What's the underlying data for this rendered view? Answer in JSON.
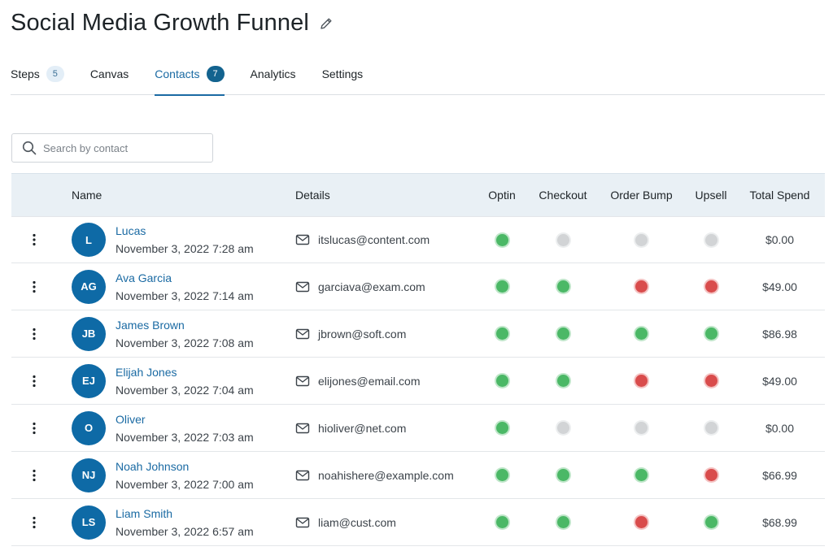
{
  "header": {
    "title": "Social Media Growth Funnel"
  },
  "tabs": [
    {
      "label": "Steps",
      "badge": "5"
    },
    {
      "label": "Canvas"
    },
    {
      "label": "Contacts",
      "badge": "7"
    },
    {
      "label": "Analytics"
    },
    {
      "label": "Settings"
    }
  ],
  "search": {
    "placeholder": "Search by contact"
  },
  "table": {
    "headers": {
      "name": "Name",
      "details": "Details",
      "optin": "Optin",
      "checkout": "Checkout",
      "order_bump": "Order Bump",
      "upsell": "Upsell",
      "total_spend": "Total Spend"
    },
    "rows": [
      {
        "initials": "L",
        "name": "Lucas",
        "date": "November 3, 2022 7:28 am",
        "email": "itslucas@content.com",
        "optin": "green",
        "checkout": "gray",
        "order_bump": "gray",
        "upsell": "gray",
        "spend": "$0.00"
      },
      {
        "initials": "AG",
        "name": "Ava Garcia",
        "date": "November 3, 2022 7:14 am",
        "email": "garciava@exam.com",
        "optin": "green",
        "checkout": "green",
        "order_bump": "red",
        "upsell": "red",
        "spend": "$49.00"
      },
      {
        "initials": "JB",
        "name": "James Brown",
        "date": "November 3, 2022 7:08 am",
        "email": "jbrown@soft.com",
        "optin": "green",
        "checkout": "green",
        "order_bump": "green",
        "upsell": "green",
        "spend": "$86.98"
      },
      {
        "initials": "EJ",
        "name": "Elijah Jones",
        "date": "November 3, 2022 7:04 am",
        "email": "elijones@email.com",
        "optin": "green",
        "checkout": "green",
        "order_bump": "red",
        "upsell": "red",
        "spend": "$49.00"
      },
      {
        "initials": "O",
        "name": "Oliver",
        "date": "November 3, 2022 7:03 am",
        "email": "hioliver@net.com",
        "optin": "green",
        "checkout": "gray",
        "order_bump": "gray",
        "upsell": "gray",
        "spend": "$0.00"
      },
      {
        "initials": "NJ",
        "name": "Noah Johnson",
        "date": "November 3, 2022 7:00 am",
        "email": "noahishere@example.com",
        "optin": "green",
        "checkout": "green",
        "order_bump": "green",
        "upsell": "red",
        "spend": "$66.99"
      },
      {
        "initials": "LS",
        "name": "Liam Smith",
        "date": "November 3, 2022 6:57 am",
        "email": "liam@cust.com",
        "optin": "green",
        "checkout": "green",
        "order_bump": "red",
        "upsell": "green",
        "spend": "$68.99"
      }
    ]
  },
  "colors": {
    "accent": "#1a6aa3",
    "avatar": "#0e6aa6",
    "status_green": "#4bb866",
    "status_red": "#d94c4c",
    "status_gray": "#d2d4d6",
    "header_bg": "#e9f0f5"
  },
  "icons": {
    "edit": "pencil-icon",
    "search": "search-icon",
    "row_menu": "kebab-menu-icon",
    "email": "envelope-icon"
  }
}
